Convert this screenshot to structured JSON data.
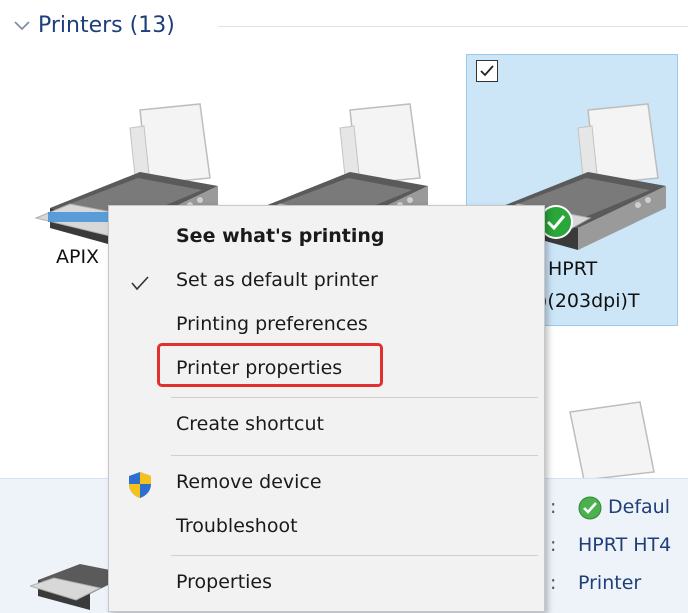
{
  "section": {
    "title": "Printers (13)",
    "chevron_icon": "chevron-down-icon"
  },
  "printers": [
    {
      "label_partial": "APIX",
      "icon": "printer-icon",
      "selected": false
    },
    {
      "label_partial": "",
      "icon": "printer-icon",
      "selected": false
    },
    {
      "label_line1": "HPRT",
      "label_line2": ")(203dpi)T",
      "icon": "printer-icon",
      "selected": true,
      "checked": true,
      "status_icon": "default-check-icon"
    }
  ],
  "details": {
    "status": "Defaul",
    "model": "HPRT HT4",
    "category": "Printer",
    "status_icon": "green-check-icon"
  },
  "context_menu": {
    "items": [
      {
        "label": "See what's printing",
        "bold": true
      },
      {
        "label": "Set as default printer",
        "icon": "checkmark-icon"
      },
      {
        "label": "Printing preferences"
      },
      {
        "label": "Printer properties",
        "highlighted": true
      },
      {
        "label": "Create shortcut"
      },
      {
        "label": "Remove device",
        "icon": "uac-shield-icon"
      },
      {
        "label": "Troubleshoot"
      },
      {
        "label": "Properties"
      }
    ]
  },
  "colors": {
    "accent_text": "#1e3f7a",
    "selection": "#cce6f8",
    "highlight_border": "#e03030"
  }
}
